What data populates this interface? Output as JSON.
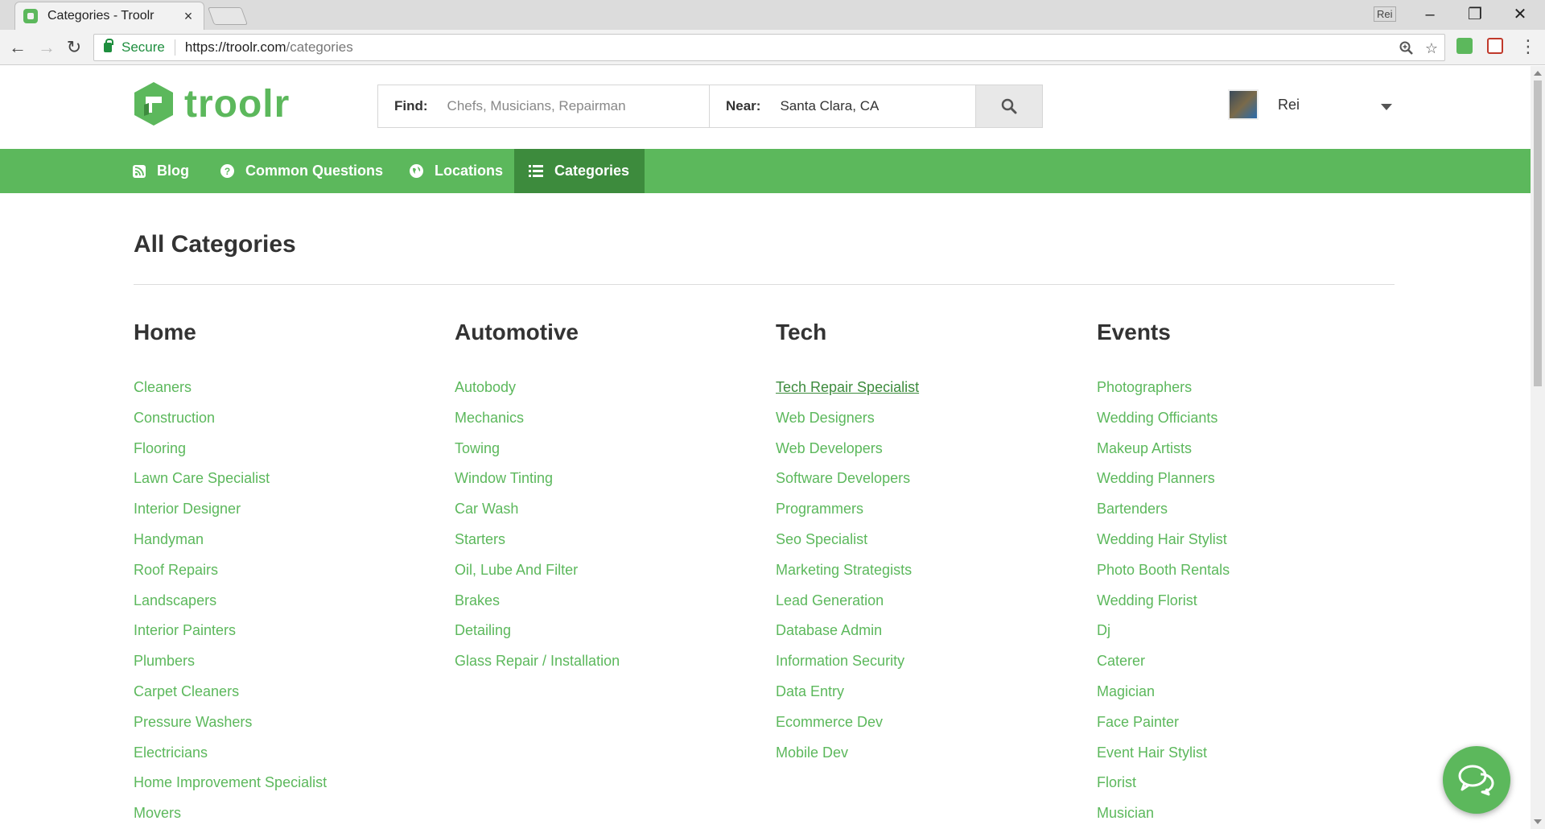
{
  "browser": {
    "tab_title": "Categories - Troolr",
    "tab_close": "×",
    "window_user": "Rei",
    "secure_label": "Secure",
    "url_host": "https://troolr.com",
    "url_path": "/categories"
  },
  "header": {
    "logo_text": "troolr",
    "search": {
      "find_label": "Find:",
      "find_placeholder": "Chefs, Musicians, Repairman",
      "near_label": "Near:",
      "near_value": "Santa Clara, CA"
    },
    "user": {
      "name": "Rei"
    }
  },
  "nav": {
    "items": [
      {
        "label": "Blog",
        "icon": "rss-icon"
      },
      {
        "label": "Common Questions",
        "icon": "question-icon"
      },
      {
        "label": "Locations",
        "icon": "globe-icon"
      },
      {
        "label": "Categories",
        "icon": "list-icon",
        "active": true
      }
    ]
  },
  "main": {
    "title": "All Categories",
    "columns": [
      {
        "title": "Home",
        "links": [
          "Cleaners",
          "Construction",
          "Flooring",
          "Lawn Care Specialist",
          "Interior Designer",
          "Handyman",
          "Roof Repairs",
          "Landscapers",
          "Interior Painters",
          "Plumbers",
          "Carpet Cleaners",
          "Pressure Washers",
          "Electricians",
          "Home Improvement Specialist",
          "Movers"
        ]
      },
      {
        "title": "Automotive",
        "links": [
          "Autobody",
          "Mechanics",
          "Towing",
          "Window Tinting",
          "Car Wash",
          "Starters",
          "Oil, Lube And Filter",
          "Brakes",
          "Detailing",
          "Glass Repair / Installation"
        ]
      },
      {
        "title": "Tech",
        "links": [
          "Tech Repair Specialist",
          "Web Designers",
          "Web Developers",
          "Software Developers",
          "Programmers",
          "Seo Specialist",
          "Marketing Strategists",
          "Lead Generation",
          "Database Admin",
          "Information Security",
          "Data Entry",
          "Ecommerce Dev",
          "Mobile Dev"
        ]
      },
      {
        "title": "Events",
        "links": [
          "Photographers",
          "Wedding Officiants",
          "Makeup Artists",
          "Wedding Planners",
          "Bartenders",
          "Wedding Hair Stylist",
          "Photo Booth Rentals",
          "Wedding Florist",
          "Dj",
          "Caterer",
          "Magician",
          "Face Painter",
          "Event Hair Stylist",
          "Florist",
          "Musician"
        ]
      }
    ]
  },
  "colors": {
    "brand": "#5cb85c",
    "brand_dark": "#3d8b3d"
  }
}
